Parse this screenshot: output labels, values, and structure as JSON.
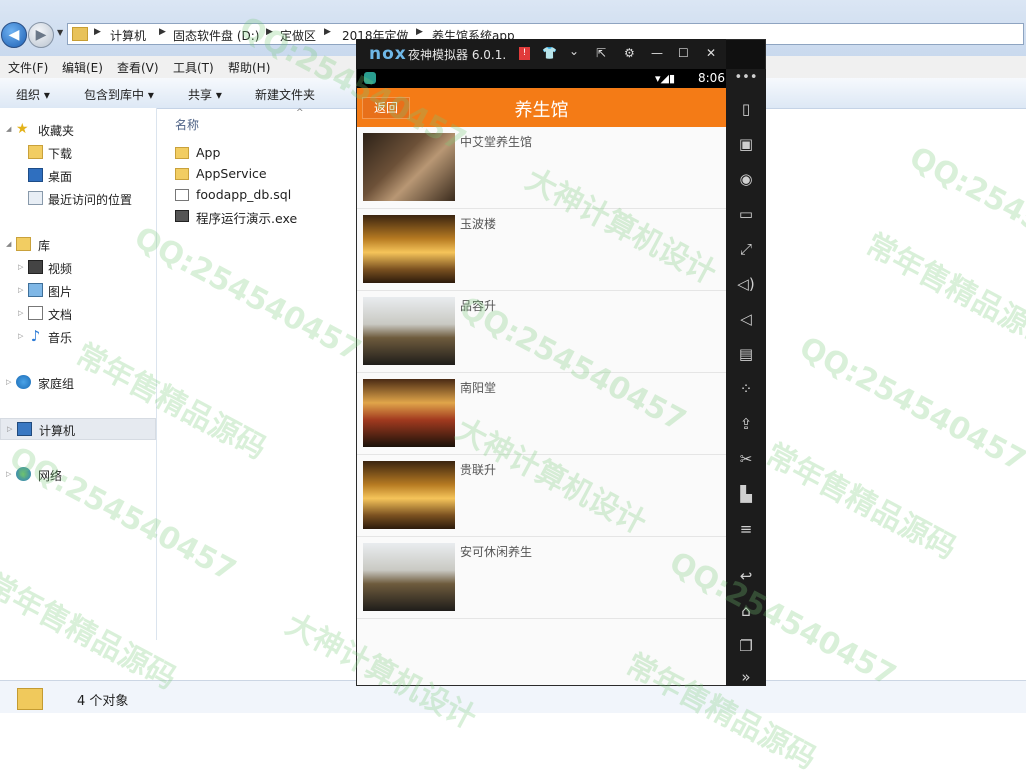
{
  "explorer": {
    "breadcrumb": [
      "计算机",
      "固态软件盘 (D:)",
      "定做区",
      "2018年定做",
      "养生馆系统app"
    ],
    "menu": [
      "文件(F)",
      "编辑(E)",
      "查看(V)",
      "工具(T)",
      "帮助(H)"
    ],
    "toolbar": [
      "组织 ▾",
      "包含到库中 ▾",
      "共享 ▾",
      "新建文件夹"
    ],
    "nav": {
      "favorites": "收藏夹",
      "downloads": "下载",
      "desktop": "桌面",
      "recent": "最近访问的位置",
      "libraries": "库",
      "videos": "视频",
      "pictures": "图片",
      "documents": "文档",
      "music": "音乐",
      "homegroup": "家庭组",
      "computer": "计算机",
      "network": "网络"
    },
    "column_header": "名称",
    "files": [
      "App",
      "AppService",
      "foodapp_db.sql",
      "程序运行演示.exe"
    ],
    "status": "4 个对象"
  },
  "nox": {
    "logo": "nox",
    "title": "夜神模拟器 6.0.1.",
    "alert": "!",
    "clock": "8:06",
    "controls": [
      "👕",
      "⌄",
      "⇱",
      "⚙",
      "—",
      "☐",
      "✕"
    ],
    "side_icons": [
      "shake-icon",
      "robot-icon",
      "location-icon",
      "screen-icon",
      "fullscreen-icon",
      "volume-up-icon",
      "volume-down-icon",
      "toolbox-icon",
      "macro-icon",
      "apk-icon",
      "scissors-icon",
      "multi-icon",
      "menu-icon",
      "back-icon",
      "home-icon",
      "recents-icon",
      "more-icon"
    ]
  },
  "app": {
    "back_label": "返回",
    "title": "养生馆",
    "items": [
      "中艾堂养生馆",
      "玉波楼",
      "品容升",
      "南阳堂",
      "贵联升",
      "安可休闲养生"
    ]
  },
  "watermark": {
    "texts": [
      "大神计算机设计",
      "QQ:254540457",
      "常年售精品源码"
    ]
  }
}
